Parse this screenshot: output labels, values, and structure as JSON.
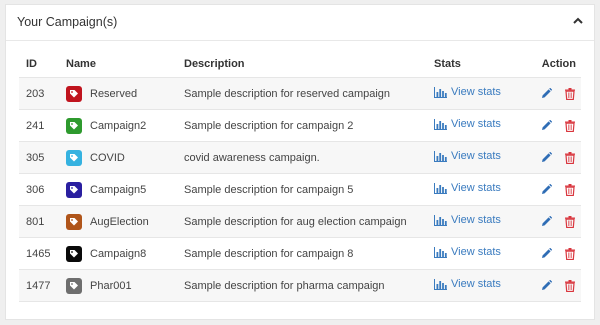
{
  "panel": {
    "title": "Your Campaign(s)",
    "collapse_icon": "chevron-up-icon"
  },
  "table": {
    "headers": {
      "id": "ID",
      "name": "Name",
      "description": "Description",
      "stats": "Stats",
      "action": "Action"
    },
    "rows": [
      {
        "id": "203",
        "name": "Reserved",
        "description": "Sample description for reserved campaign",
        "stats": "View stats",
        "color": "#c0141e"
      },
      {
        "id": "241",
        "name": "Campaign2",
        "description": "Sample description for campaign 2",
        "stats": "View stats",
        "color": "#2e9a2e"
      },
      {
        "id": "305",
        "name": "COVID",
        "description": "covid awareness campaign.",
        "stats": "View stats",
        "color": "#35b2e0"
      },
      {
        "id": "306",
        "name": "Campaign5",
        "description": "Sample description for campaign 5",
        "stats": "View stats",
        "color": "#2a1fa0"
      },
      {
        "id": "801",
        "name": "AugElection",
        "description": "Sample description for aug election campaign",
        "stats": "View stats",
        "color": "#b0551a"
      },
      {
        "id": "1465",
        "name": "Campaign8",
        "description": "Sample description for campaign 8",
        "stats": "View stats",
        "color": "#0a0a0a"
      },
      {
        "id": "1477",
        "name": "Phar001",
        "description": "Sample description for pharma campaign",
        "stats": "View stats",
        "color": "#6e6e6e"
      }
    ]
  },
  "icons": {
    "tag": "tag-icon",
    "stats": "bar-chart-icon",
    "edit": "pencil-icon",
    "delete": "trash-icon"
  },
  "colors": {
    "link": "#3a7bbf",
    "edit": "#2f6db5",
    "delete": "#d9363e"
  }
}
